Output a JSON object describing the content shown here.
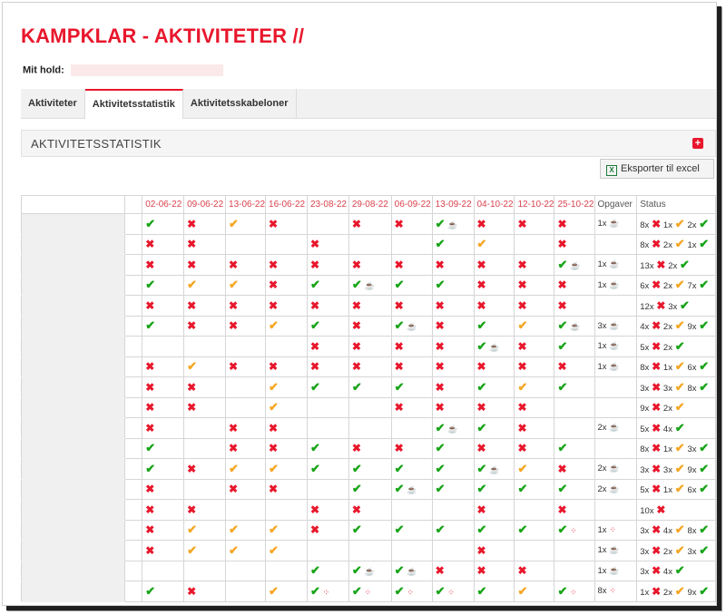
{
  "title": "KAMPKLAR - AKTIVITETER //",
  "team": {
    "label": "Mit hold:",
    "value": ""
  },
  "tabs": [
    {
      "label": "Aktiviteter",
      "active": false
    },
    {
      "label": "Aktivitetsstatistik",
      "active": true
    },
    {
      "label": "Aktivitetsskabeloner",
      "active": false
    }
  ],
  "section": {
    "title": "AKTIVITETSSTATISTIK",
    "expand_icon": "plus-square-icon"
  },
  "export": {
    "label": "Eksporter til excel",
    "icon": "excel-icon"
  },
  "icons": {
    "check": "✔",
    "cross": "✖",
    "cup": "☕",
    "dots": "⁘",
    "green": "#18a418",
    "orange": "#f5a623",
    "red": "#e8172c"
  },
  "columns": {
    "dates": [
      "02-06-22",
      "09-06-22",
      "13-06-22",
      "16-06-22",
      "23-08-22",
      "29-08-22",
      "06-09-22",
      "13-09-22",
      "04-10-22",
      "12-10-22",
      "25-10-22"
    ],
    "tasks": "Opgaver",
    "status": "Status"
  },
  "rows": [
    {
      "cells": [
        [
          "g"
        ],
        [
          "r"
        ],
        [
          "o"
        ],
        [
          "r"
        ],
        [],
        [
          "r"
        ],
        [
          "r"
        ],
        [
          "g",
          "c"
        ],
        [
          "r"
        ],
        [
          "r"
        ],
        [
          "r"
        ]
      ],
      "tasks": [
        [
          "t",
          "1x"
        ],
        [
          "c"
        ]
      ],
      "status": [
        [
          "t",
          "8x"
        ],
        [
          "r"
        ],
        [
          "t",
          "1x"
        ],
        [
          "o"
        ],
        [
          "t",
          "2x"
        ],
        [
          "g"
        ]
      ]
    },
    {
      "cells": [
        [
          "r"
        ],
        [
          "r"
        ],
        [],
        [],
        [
          "r"
        ],
        [],
        [],
        [
          "g"
        ],
        [
          "o"
        ],
        [],
        [
          "r"
        ]
      ],
      "tasks": [],
      "status": [
        [
          "t",
          "8x"
        ],
        [
          "r"
        ],
        [
          "t",
          "2x"
        ],
        [
          "o"
        ],
        [
          "t",
          "1x"
        ],
        [
          "g"
        ]
      ]
    },
    {
      "cells": [
        [
          "r"
        ],
        [
          "r"
        ],
        [
          "r"
        ],
        [
          "r"
        ],
        [
          "r"
        ],
        [
          "r"
        ],
        [
          "r"
        ],
        [
          "r"
        ],
        [
          "r"
        ],
        [
          "r"
        ],
        [
          "g",
          "c"
        ]
      ],
      "tasks": [
        [
          "t",
          "1x"
        ],
        [
          "c"
        ]
      ],
      "status": [
        [
          "t",
          "13x"
        ],
        [
          "r"
        ],
        [
          "t",
          "2x"
        ],
        [
          "g"
        ]
      ]
    },
    {
      "cells": [
        [
          "g"
        ],
        [
          "o"
        ],
        [
          "o"
        ],
        [
          "r"
        ],
        [
          "g"
        ],
        [
          "g",
          "c"
        ],
        [
          "g"
        ],
        [
          "g"
        ],
        [
          "r"
        ],
        [
          "r"
        ],
        [
          "r"
        ]
      ],
      "tasks": [
        [
          "t",
          "1x"
        ],
        [
          "c"
        ]
      ],
      "status": [
        [
          "t",
          "6x"
        ],
        [
          "r"
        ],
        [
          "t",
          "2x"
        ],
        [
          "o"
        ],
        [
          "t",
          "7x"
        ],
        [
          "g"
        ]
      ]
    },
    {
      "cells": [
        [
          "r"
        ],
        [
          "r"
        ],
        [
          "r"
        ],
        [
          "r"
        ],
        [
          "r"
        ],
        [
          "r"
        ],
        [
          "r"
        ],
        [
          "r"
        ],
        [
          "r"
        ],
        [
          "r"
        ],
        [
          "r"
        ]
      ],
      "tasks": [],
      "status": [
        [
          "t",
          "12x"
        ],
        [
          "r"
        ],
        [
          "t",
          "3x"
        ],
        [
          "g"
        ]
      ]
    },
    {
      "cells": [
        [
          "g"
        ],
        [
          "r"
        ],
        [
          "r"
        ],
        [
          "o"
        ],
        [
          "g"
        ],
        [
          "r"
        ],
        [
          "g",
          "c"
        ],
        [
          "r"
        ],
        [
          "g"
        ],
        [
          "o"
        ],
        [
          "g",
          "c"
        ]
      ],
      "tasks": [
        [
          "t",
          "3x"
        ],
        [
          "c"
        ]
      ],
      "status": [
        [
          "t",
          "4x"
        ],
        [
          "r"
        ],
        [
          "t",
          "2x"
        ],
        [
          "o"
        ],
        [
          "t",
          "9x"
        ],
        [
          "g"
        ]
      ]
    },
    {
      "cells": [
        [],
        [],
        [],
        [],
        [
          "r"
        ],
        [
          "r"
        ],
        [
          "r"
        ],
        [
          "r"
        ],
        [
          "g",
          "c"
        ],
        [
          "r"
        ],
        [
          "g"
        ]
      ],
      "tasks": [
        [
          "t",
          "1x"
        ],
        [
          "c"
        ]
      ],
      "status": [
        [
          "t",
          "5x"
        ],
        [
          "r"
        ],
        [
          "t",
          "2x"
        ],
        [
          "g"
        ]
      ]
    },
    {
      "cells": [
        [
          "r"
        ],
        [
          "o"
        ],
        [
          "r"
        ],
        [
          "r"
        ],
        [
          "r"
        ],
        [
          "r"
        ],
        [
          "r"
        ],
        [
          "r"
        ],
        [
          "r"
        ],
        [
          "r"
        ],
        [
          "r"
        ]
      ],
      "tasks": [
        [
          "t",
          "1x"
        ],
        [
          "c"
        ]
      ],
      "status": [
        [
          "t",
          "8x"
        ],
        [
          "r"
        ],
        [
          "t",
          "1x"
        ],
        [
          "o"
        ],
        [
          "t",
          "6x"
        ],
        [
          "g"
        ]
      ]
    },
    {
      "cells": [
        [
          "r"
        ],
        [
          "r"
        ],
        [],
        [
          "o"
        ],
        [
          "g"
        ],
        [
          "g"
        ],
        [
          "g"
        ],
        [
          "r"
        ],
        [
          "g"
        ],
        [
          "o"
        ],
        [
          "g"
        ]
      ],
      "tasks": [],
      "status": [
        [
          "t",
          "3x"
        ],
        [
          "r"
        ],
        [
          "t",
          "3x"
        ],
        [
          "o"
        ],
        [
          "t",
          "8x"
        ],
        [
          "g"
        ]
      ]
    },
    {
      "cells": [
        [
          "r"
        ],
        [
          "r"
        ],
        [],
        [
          "o"
        ],
        [],
        [],
        [
          "r"
        ],
        [
          "r"
        ],
        [
          "r"
        ],
        [
          "r"
        ],
        []
      ],
      "tasks": [],
      "status": [
        [
          "t",
          "9x"
        ],
        [
          "r"
        ],
        [
          "t",
          "2x"
        ],
        [
          "o"
        ]
      ]
    },
    {
      "cells": [
        [
          "r"
        ],
        [],
        [
          "r"
        ],
        [
          "r"
        ],
        [],
        [],
        [],
        [
          "g",
          "c"
        ],
        [
          "g"
        ],
        [
          "r"
        ],
        []
      ],
      "tasks": [
        [
          "t",
          "2x"
        ],
        [
          "c"
        ]
      ],
      "status": [
        [
          "t",
          "5x"
        ],
        [
          "r"
        ],
        [
          "t",
          "4x"
        ],
        [
          "g"
        ]
      ]
    },
    {
      "cells": [
        [
          "g"
        ],
        [],
        [
          "r"
        ],
        [
          "r"
        ],
        [
          "g"
        ],
        [
          "r"
        ],
        [
          "r"
        ],
        [
          "g"
        ],
        [
          "r"
        ],
        [
          "r"
        ],
        [
          "g"
        ]
      ],
      "tasks": [],
      "status": [
        [
          "t",
          "8x"
        ],
        [
          "r"
        ],
        [
          "t",
          "1x"
        ],
        [
          "o"
        ],
        [
          "t",
          "3x"
        ],
        [
          "g"
        ]
      ]
    },
    {
      "cells": [
        [
          "g"
        ],
        [
          "r"
        ],
        [
          "o"
        ],
        [
          "o"
        ],
        [
          "g"
        ],
        [
          "g"
        ],
        [
          "g"
        ],
        [
          "g"
        ],
        [
          "g",
          "c"
        ],
        [
          "o"
        ],
        [
          "r"
        ]
      ],
      "tasks": [
        [
          "t",
          "2x"
        ],
        [
          "c"
        ]
      ],
      "status": [
        [
          "t",
          "3x"
        ],
        [
          "r"
        ],
        [
          "t",
          "3x"
        ],
        [
          "o"
        ],
        [
          "t",
          "9x"
        ],
        [
          "g"
        ]
      ]
    },
    {
      "cells": [
        [
          "r"
        ],
        [],
        [
          "r"
        ],
        [
          "r"
        ],
        [],
        [
          "g"
        ],
        [
          "g",
          "c"
        ],
        [
          "g"
        ],
        [
          "g"
        ],
        [
          "g"
        ],
        [
          "g"
        ]
      ],
      "tasks": [
        [
          "t",
          "2x"
        ],
        [
          "c"
        ]
      ],
      "status": [
        [
          "t",
          "5x"
        ],
        [
          "r"
        ],
        [
          "t",
          "1x"
        ],
        [
          "o"
        ],
        [
          "t",
          "6x"
        ],
        [
          "g"
        ]
      ]
    },
    {
      "cells": [
        [
          "r"
        ],
        [
          "r"
        ],
        [],
        [],
        [
          "r"
        ],
        [
          "r"
        ],
        [],
        [],
        [
          "r"
        ],
        [],
        [
          "r"
        ]
      ],
      "tasks": [],
      "status": [
        [
          "t",
          "10x"
        ],
        [
          "r"
        ]
      ]
    },
    {
      "cells": [
        [
          "r"
        ],
        [
          "o"
        ],
        [
          "o"
        ],
        [
          "o"
        ],
        [
          "r"
        ],
        [
          "g"
        ],
        [
          "g"
        ],
        [
          "g"
        ],
        [
          "g"
        ],
        [
          "g"
        ],
        [
          "g",
          "d"
        ]
      ],
      "tasks": [
        [
          "t",
          "1x"
        ],
        [
          "d"
        ]
      ],
      "status": [
        [
          "t",
          "3x"
        ],
        [
          "r"
        ],
        [
          "t",
          "4x"
        ],
        [
          "o"
        ],
        [
          "t",
          "8x"
        ],
        [
          "g"
        ]
      ]
    },
    {
      "cells": [
        [
          "r"
        ],
        [
          "o"
        ],
        [
          "o"
        ],
        [
          "o"
        ],
        [],
        [],
        [],
        [],
        [
          "r"
        ],
        [],
        []
      ],
      "tasks": [
        [
          "t",
          "1x"
        ],
        [
          "c"
        ]
      ],
      "status": [
        [
          "t",
          "3x"
        ],
        [
          "r"
        ],
        [
          "t",
          "2x"
        ],
        [
          "o"
        ],
        [
          "t",
          "3x"
        ],
        [
          "g"
        ]
      ]
    },
    {
      "cells": [
        [],
        [],
        [],
        [],
        [
          "g"
        ],
        [
          "g",
          "c"
        ],
        [
          "g",
          "c"
        ],
        [
          "r"
        ],
        [
          "r"
        ],
        [
          "r"
        ],
        []
      ],
      "tasks": [
        [
          "t",
          "1x"
        ],
        [
          "c"
        ]
      ],
      "status": [
        [
          "t",
          "3x"
        ],
        [
          "r"
        ],
        [
          "t",
          "4x"
        ],
        [
          "g"
        ]
      ]
    },
    {
      "cells": [
        [
          "g"
        ],
        [
          "r"
        ],
        [],
        [
          "o"
        ],
        [
          "g",
          "d"
        ],
        [
          "g",
          "d"
        ],
        [
          "g",
          "d"
        ],
        [
          "g",
          "d"
        ],
        [
          "g"
        ],
        [
          "o"
        ],
        [
          "g",
          "d"
        ]
      ],
      "tasks": [
        [
          "t",
          "8x"
        ],
        [
          "d"
        ]
      ],
      "status": [
        [
          "t",
          "1x"
        ],
        [
          "r"
        ],
        [
          "t",
          "2x"
        ],
        [
          "o"
        ],
        [
          "t",
          "9x"
        ],
        [
          "g"
        ]
      ]
    }
  ]
}
